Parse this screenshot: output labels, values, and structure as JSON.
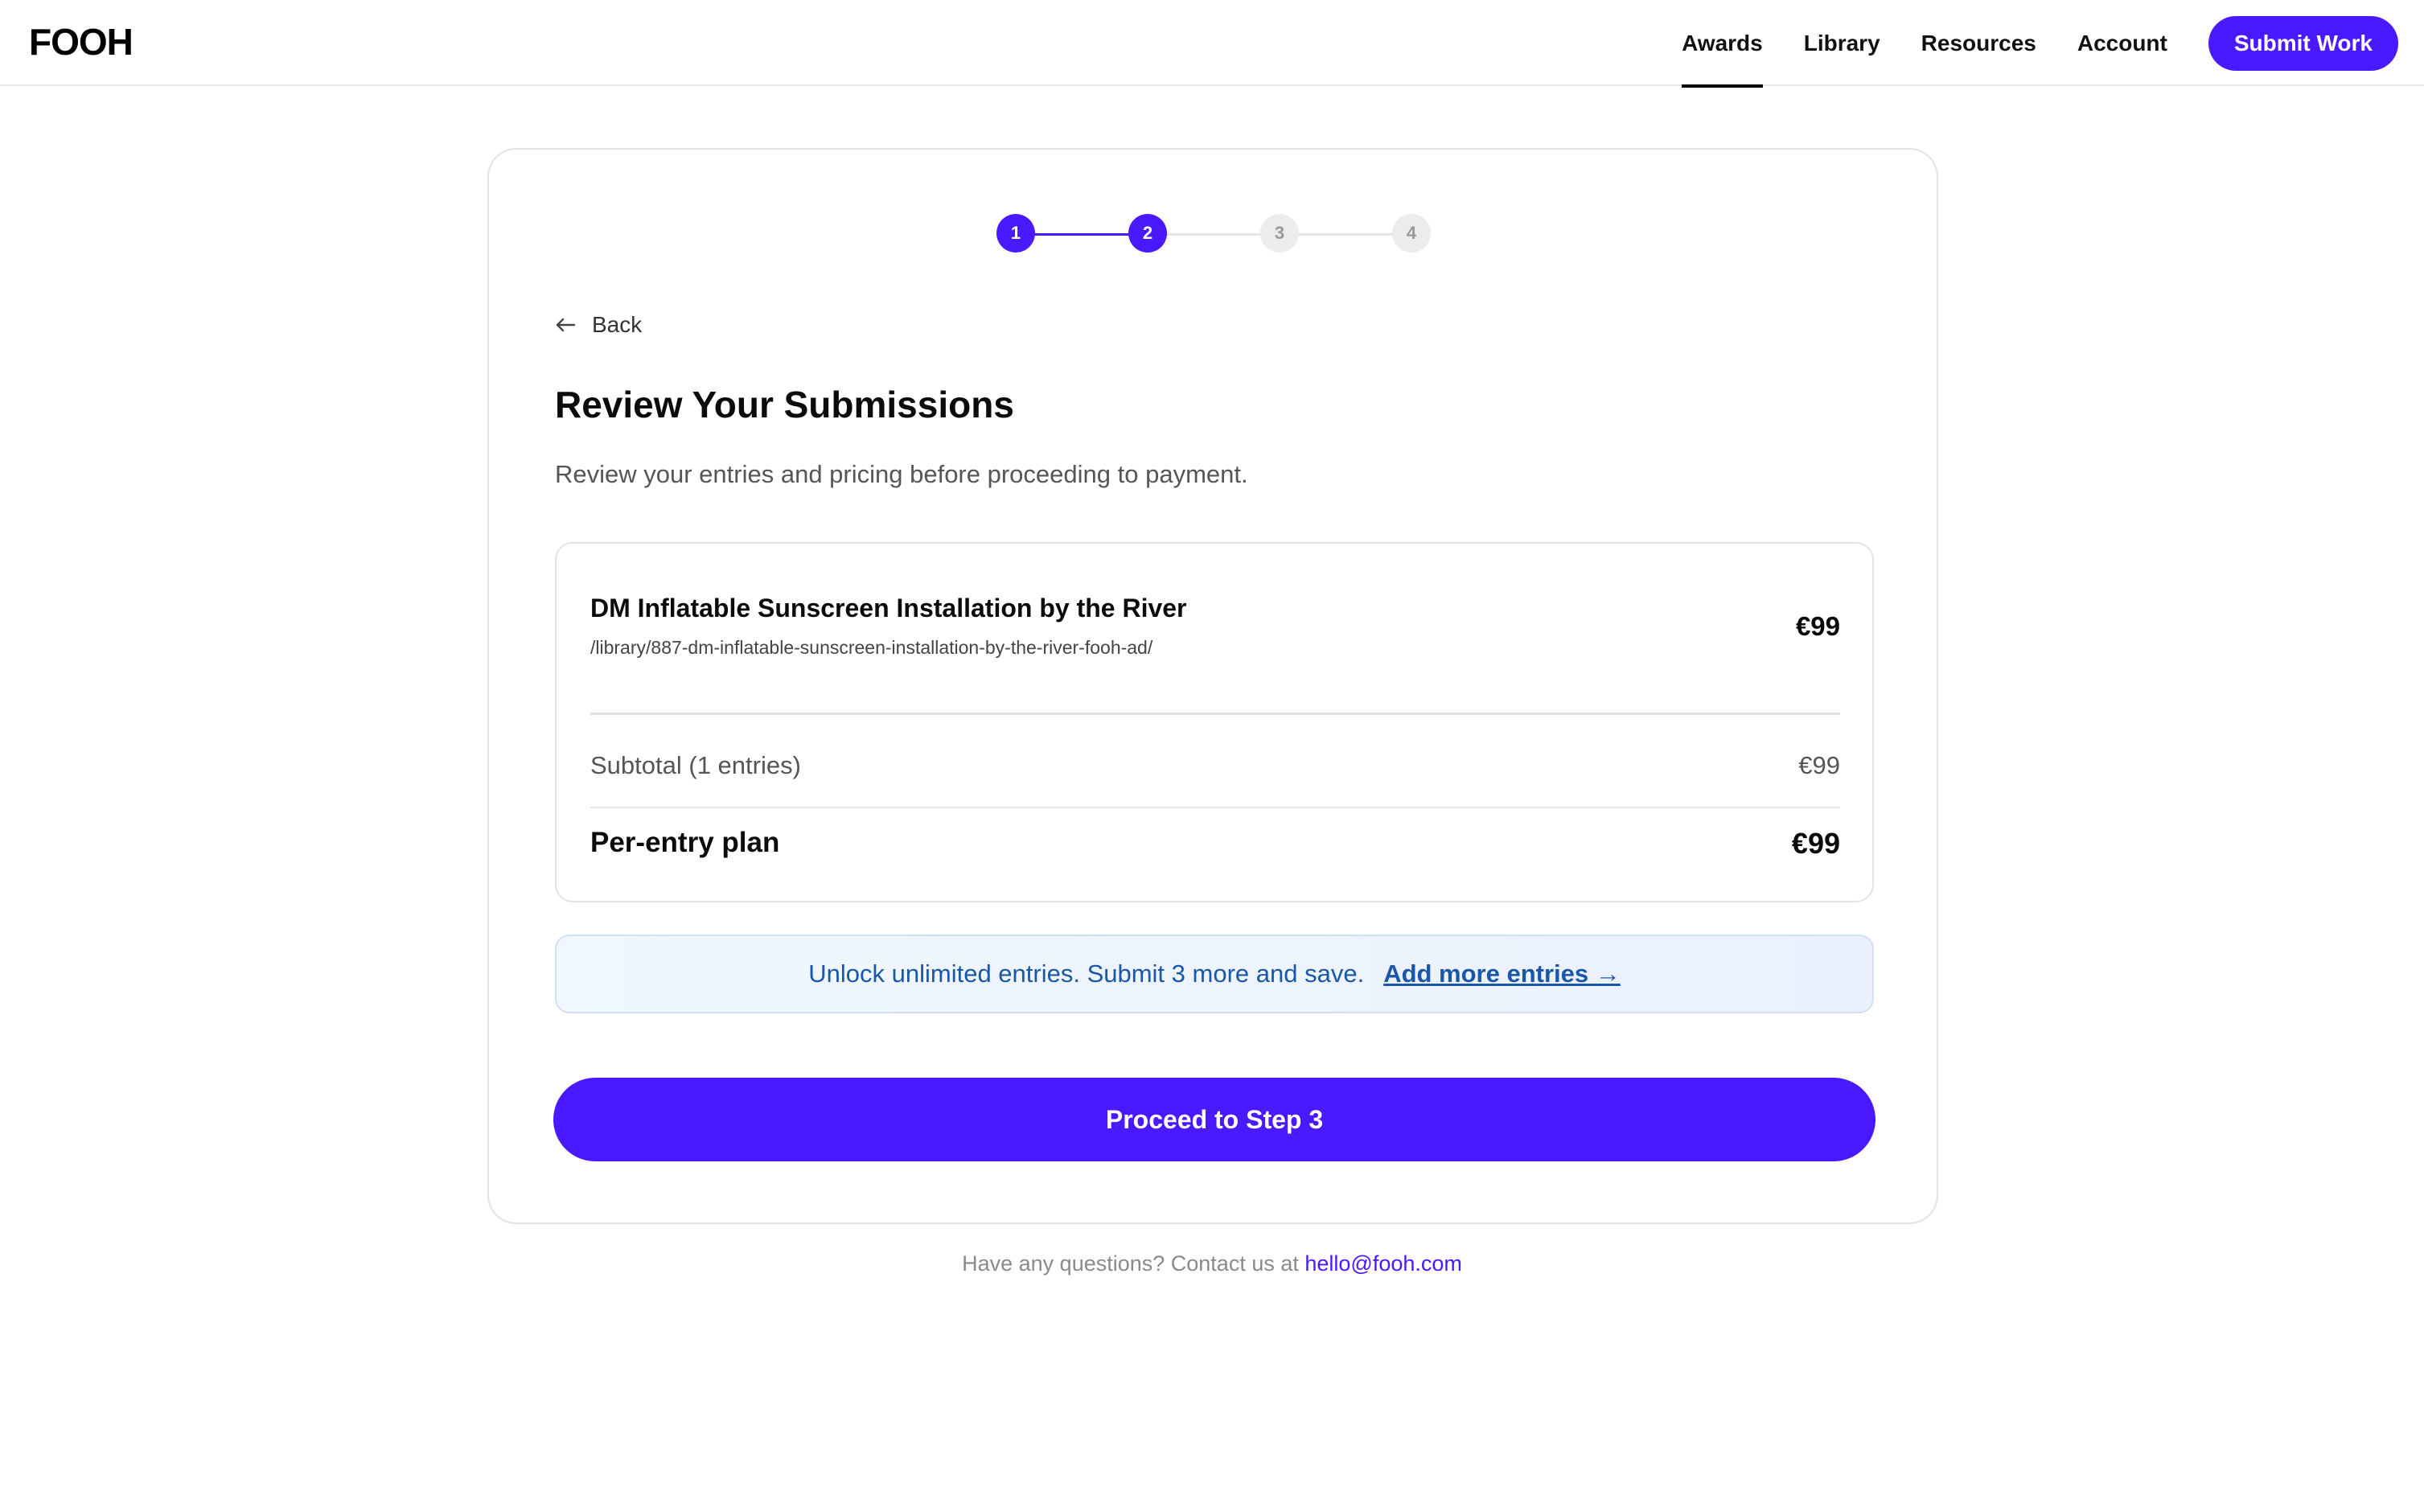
{
  "header": {
    "logo": "FOOH",
    "nav": [
      {
        "label": "Awards",
        "active": true
      },
      {
        "label": "Library",
        "active": false
      },
      {
        "label": "Resources",
        "active": false
      },
      {
        "label": "Account",
        "active": false
      }
    ],
    "cta_label": "Submit Work"
  },
  "stepper": {
    "steps": [
      "1",
      "2",
      "3",
      "4"
    ],
    "current": 2
  },
  "back_label": "Back",
  "page": {
    "title": "Review Your Submissions",
    "subtitle": "Review your entries and pricing before proceeding to payment."
  },
  "summary": {
    "entry": {
      "title": "DM Inflatable Sunscreen Installation by the River",
      "path": "/library/887-dm-inflatable-sunscreen-installation-by-the-river-fooh-ad/",
      "price": "€99"
    },
    "subtotal_label": "Subtotal (1 entries)",
    "subtotal_value": "€99",
    "plan_label": "Per-entry plan",
    "plan_value": "€99"
  },
  "banner": {
    "text": "Unlock unlimited entries. Submit 3 more and save.",
    "link": "Add more entries →"
  },
  "proceed_label": "Proceed to Step 3",
  "footer": {
    "text": "Have any questions? Contact us at ",
    "email": "hello@fooh.com"
  },
  "colors": {
    "accent": "#4a19ff",
    "banner_text": "#1a57a8"
  }
}
